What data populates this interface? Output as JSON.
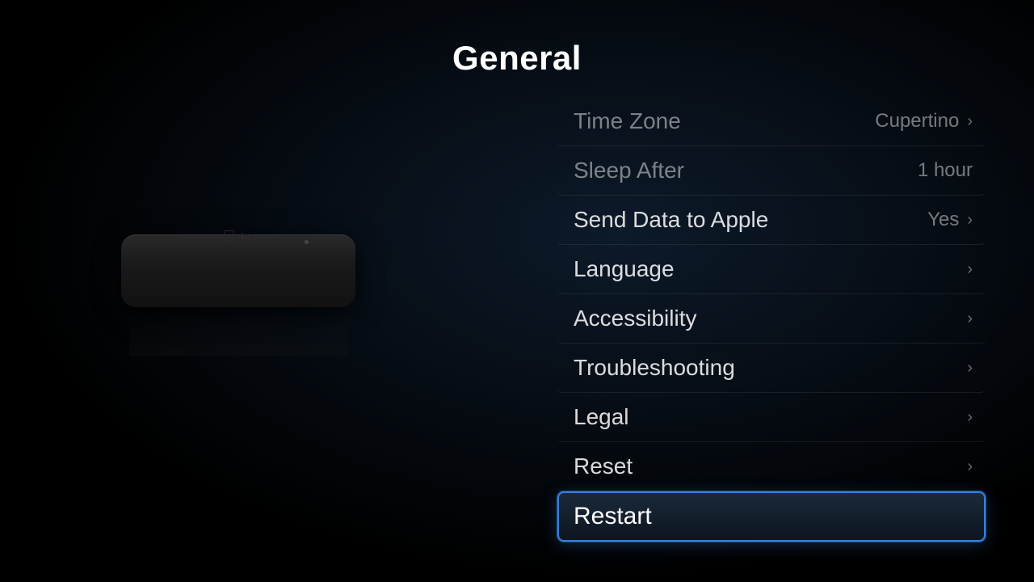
{
  "page": {
    "title": "General",
    "accent_color": "#3a7bd5"
  },
  "menu": {
    "items": [
      {
        "id": "time-zone",
        "label": "Time Zone",
        "value": "Cupertino",
        "has_chevron": true,
        "dimmed": true,
        "selected": false
      },
      {
        "id": "sleep-after",
        "label": "Sleep After",
        "value": "1 hour",
        "has_chevron": false,
        "dimmed": true,
        "selected": false
      },
      {
        "id": "send-data",
        "label": "Send Data to Apple",
        "value": "Yes",
        "has_chevron": true,
        "dimmed": false,
        "selected": false
      },
      {
        "id": "language",
        "label": "Language",
        "value": "",
        "has_chevron": true,
        "dimmed": false,
        "selected": false
      },
      {
        "id": "accessibility",
        "label": "Accessibility",
        "value": "",
        "has_chevron": true,
        "dimmed": false,
        "selected": false
      },
      {
        "id": "troubleshooting",
        "label": "Troubleshooting",
        "value": "",
        "has_chevron": true,
        "dimmed": false,
        "selected": false
      },
      {
        "id": "legal",
        "label": "Legal",
        "value": "",
        "has_chevron": true,
        "dimmed": false,
        "selected": false
      },
      {
        "id": "reset",
        "label": "Reset",
        "value": "",
        "has_chevron": true,
        "dimmed": false,
        "selected": false
      },
      {
        "id": "restart",
        "label": "Restart",
        "value": "",
        "has_chevron": false,
        "dimmed": false,
        "selected": true
      }
    ]
  },
  "device": {
    "logo_text": " tv",
    "apple_symbol": ""
  }
}
